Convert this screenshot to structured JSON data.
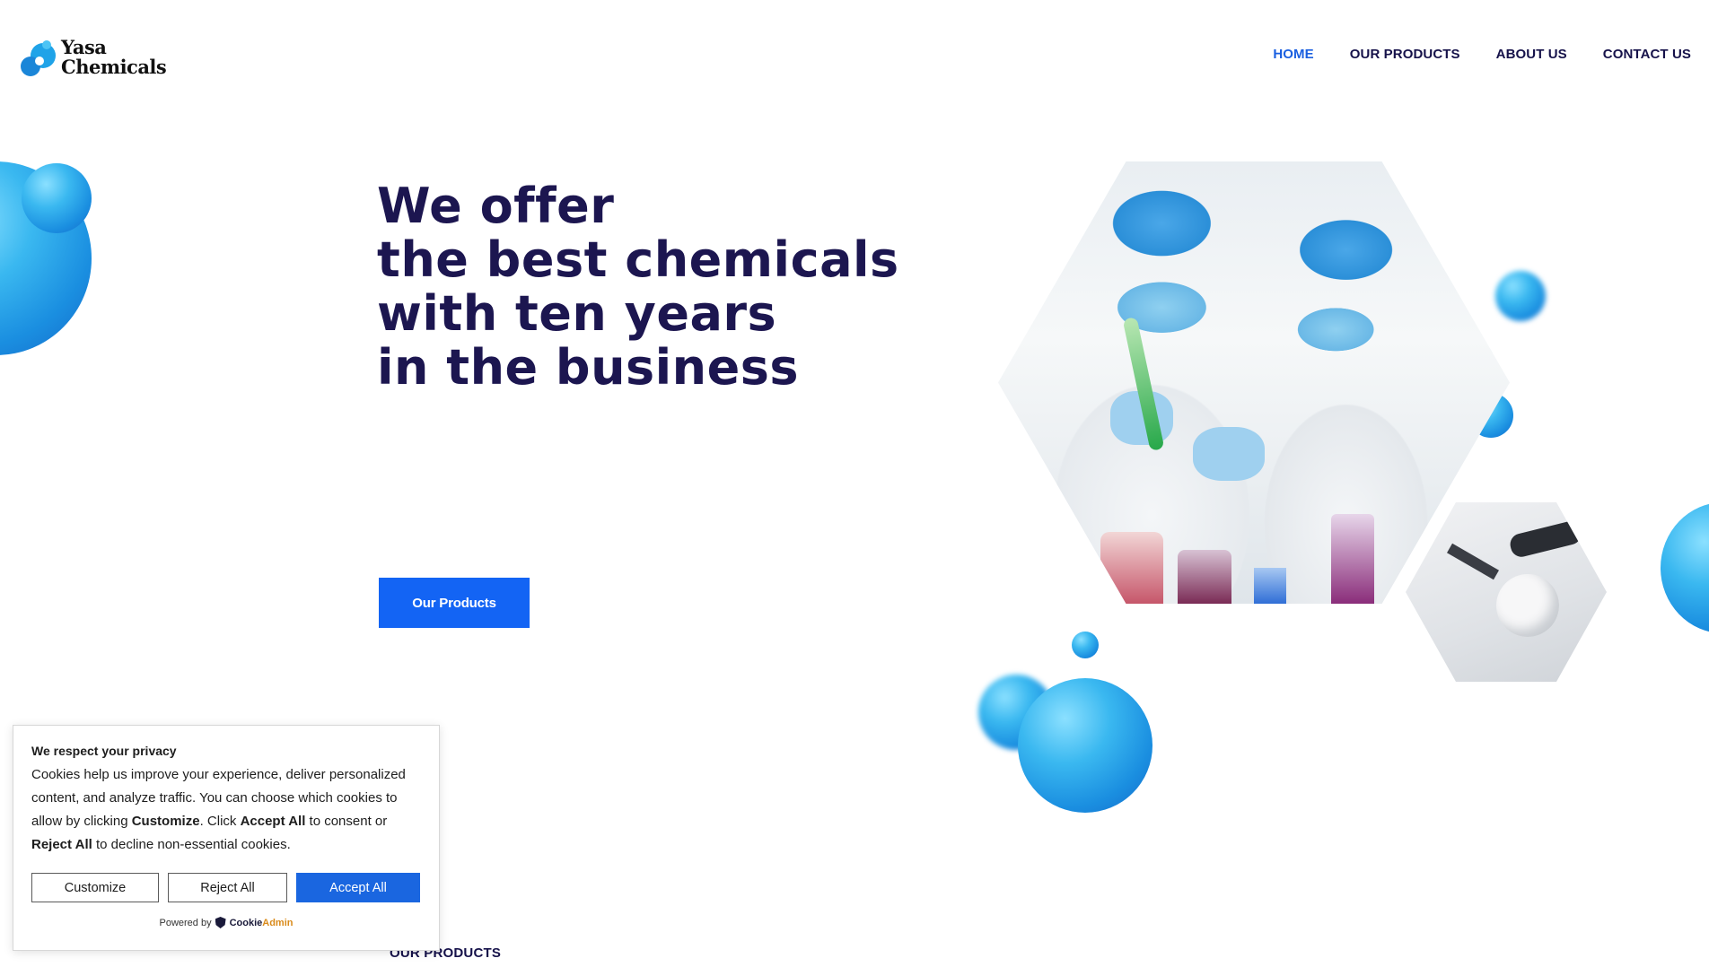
{
  "brand": {
    "name_line1": "Yasa",
    "name_line2": "Chemicals",
    "logo_icon": "bubble-logo-icon"
  },
  "nav": {
    "items": [
      {
        "label": "HOME",
        "active": true
      },
      {
        "label": "OUR PRODUCTS",
        "active": false
      },
      {
        "label": "ABOUT US",
        "active": false
      },
      {
        "label": "CONTACT US",
        "active": false
      }
    ]
  },
  "hero": {
    "lines": [
      "We offer",
      "the best chemicals",
      "with ten years",
      "in the business"
    ],
    "button_label": "Our Products"
  },
  "cookie_banner": {
    "title": "We respect your privacy",
    "text_part1": "Cookies help us improve your experience, deliver personalized content, and analyze traffic. You can choose which cookies to allow by clicking ",
    "text_customize": "Customize",
    "text_part2": ". Click ",
    "text_accept": "Accept All",
    "text_part3": " to consent or ",
    "text_reject": "Reject All",
    "text_part4": " to decline non-essential cookies.",
    "buttons": {
      "customize": "Customize",
      "reject": "Reject All",
      "accept": "Accept All"
    },
    "powered_by": "Powered by",
    "powered_brand_a": "Cookie",
    "powered_brand_b": "Admin"
  },
  "section": {
    "label": "OUR PRODUCTS"
  },
  "colors": {
    "accent": "#1364f4",
    "heading": "#1c1650",
    "nav_active": "#1a5fe0"
  }
}
